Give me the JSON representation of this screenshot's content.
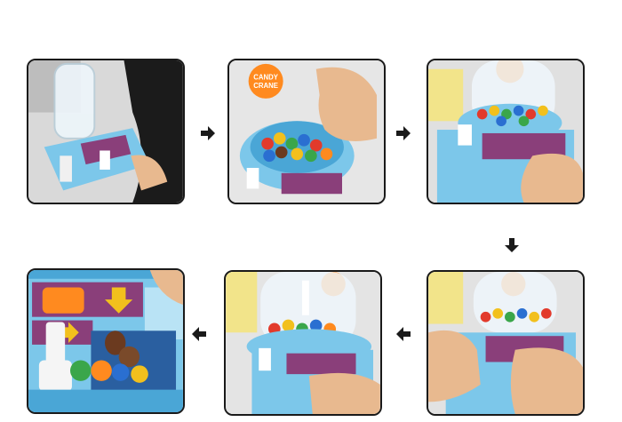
{
  "steps": [
    {
      "id": "step-1",
      "action": "attach-dome"
    },
    {
      "id": "step-2",
      "action": "fill-candy"
    },
    {
      "id": "step-3",
      "action": "turn-knob"
    },
    {
      "id": "step-4",
      "action": "operate-crane"
    },
    {
      "id": "step-5",
      "action": "drop-candy"
    },
    {
      "id": "step-6",
      "action": "collect-candy"
    }
  ],
  "logo_text": {
    "line1": "CANDY",
    "line2": "CRANE"
  },
  "colors": {
    "machine_blue": "#7cc7ea",
    "machine_dark_blue": "#4aa6d6",
    "panel_purple": "#8a3f7a",
    "candy_colors": [
      "#e23a2c",
      "#f2c01d",
      "#3aa64a",
      "#2a6fd1",
      "#ff8a1f",
      "#6b3a1f"
    ],
    "arrow_color": "#1a1a1a",
    "panel_border": "#1a1a1a"
  },
  "flow_arrows": [
    {
      "id": "arrow-1",
      "direction": "right"
    },
    {
      "id": "arrow-2",
      "direction": "right"
    },
    {
      "id": "arrow-3",
      "direction": "down"
    },
    {
      "id": "arrow-4",
      "direction": "left"
    },
    {
      "id": "arrow-5",
      "direction": "left"
    }
  ]
}
